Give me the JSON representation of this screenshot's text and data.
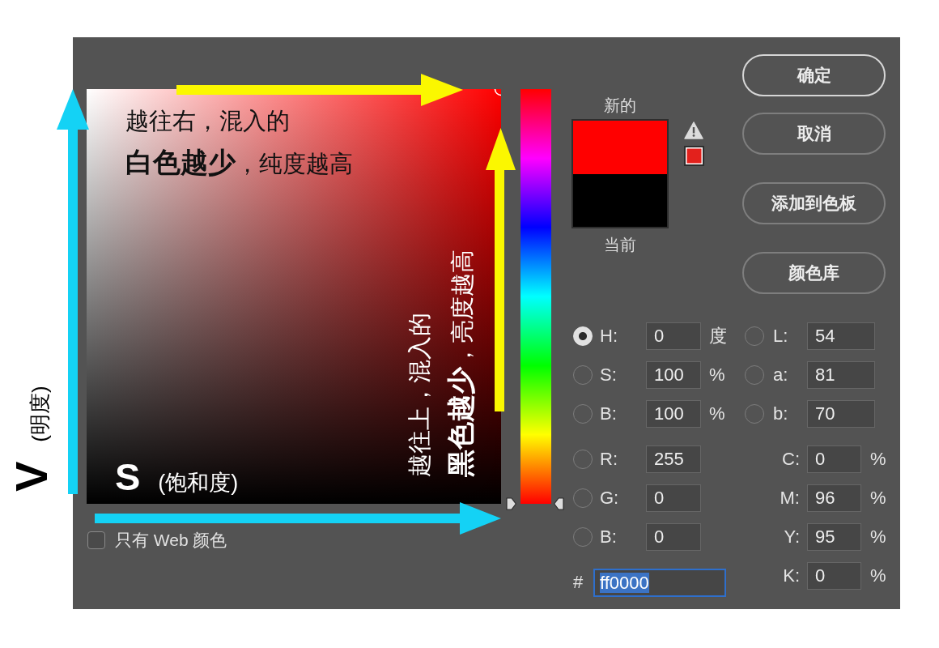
{
  "annotations": {
    "brightness_axis": {
      "letter": "V",
      "name": "(明度)"
    },
    "saturation_axis": {
      "letter": "S",
      "name": "(饱和度)"
    },
    "saturation_note": [
      "越往右，混入的",
      "**白色越少**，纯度越高"
    ],
    "brightness_note": [
      "越往上，混入的",
      "**黑色越少**，亮度越高"
    ]
  },
  "hue_slider": {
    "level": 0
  },
  "web_colors_only": {
    "label": "只有 Web 颜色",
    "checked": false
  },
  "preview": [
    {
      "label": "新的",
      "color": "#ff0000"
    },
    {
      "label": "当前",
      "color": "#000000"
    }
  ],
  "gamut_warning": {
    "shown": true,
    "color": "#e3211c"
  },
  "dialog_buttons": [
    {
      "label": "确定",
      "default": true
    },
    {
      "label": "取消",
      "default": false
    }
  ],
  "swatch_buttons": [
    {
      "label": "添加到色板",
      "default": false
    },
    {
      "label": "颜色库",
      "default": false
    }
  ],
  "hsb": [
    {
      "label": "H:",
      "value": "0",
      "unit": "度",
      "selected": true
    },
    {
      "label": "S:",
      "value": "100",
      "unit": "%",
      "selected": false
    },
    {
      "label": "B:",
      "value": "100",
      "unit": "%",
      "selected": false
    }
  ],
  "rgb": [
    {
      "label": "R:",
      "value": "255",
      "selected": false
    },
    {
      "label": "G:",
      "value": "0",
      "selected": false
    },
    {
      "label": "B:",
      "value": "0",
      "selected": false
    }
  ],
  "hex": {
    "label": "#",
    "value": "ff0000",
    "focused": true
  },
  "lab": [
    {
      "label": "L:",
      "value": "54",
      "selected": false
    },
    {
      "label": "a:",
      "value": "81",
      "selected": false
    },
    {
      "label": "b:",
      "value": "70",
      "selected": false
    }
  ],
  "cmyk": [
    {
      "label": "C:",
      "value": "0",
      "unit": "%"
    },
    {
      "label": "M:",
      "value": "96",
      "unit": "%"
    },
    {
      "label": "Y:",
      "value": "95",
      "unit": "%"
    },
    {
      "label": "K:",
      "value": "0",
      "unit": "%"
    }
  ]
}
